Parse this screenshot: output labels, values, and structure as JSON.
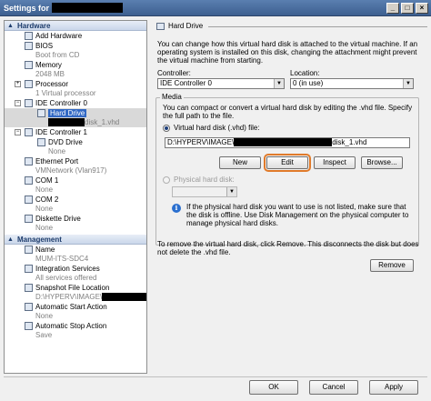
{
  "window": {
    "title": "Settings for"
  },
  "titlebar_buttons": [
    "_",
    "□",
    "×"
  ],
  "tree": {
    "hardware_header": "Hardware",
    "management_header": "Management",
    "hardware_items": [
      {
        "label": "Add Hardware",
        "sub": ""
      },
      {
        "label": "BIOS",
        "sub": "Boot from CD"
      },
      {
        "label": "Memory",
        "sub": "2048 MB"
      },
      {
        "label": "Processor",
        "sub": "1 Virtual processor"
      },
      {
        "label": "IDE Controller 0",
        "sub": ""
      },
      {
        "label": "Hard Drive",
        "sub": "disk_1.vhd"
      },
      {
        "label": "IDE Controller 1",
        "sub": ""
      },
      {
        "label": "DVD Drive",
        "sub": "None"
      },
      {
        "label": "Ethernet Port",
        "sub": "VMNetwork (Vlan917)"
      },
      {
        "label": "COM 1",
        "sub": "None"
      },
      {
        "label": "COM 2",
        "sub": "None"
      },
      {
        "label": "Diskette Drive",
        "sub": "None"
      }
    ],
    "management_items": [
      {
        "label": "Name",
        "sub": "MUM-ITS-SDC4"
      },
      {
        "label": "Integration Services",
        "sub": "All services offered"
      },
      {
        "label": "Snapshot File Location",
        "sub": "D:\\HYPERV\\IMAGE\\"
      },
      {
        "label": "Automatic Start Action",
        "sub": "None"
      },
      {
        "label": "Automatic Stop Action",
        "sub": "Save"
      }
    ]
  },
  "panel": {
    "title": "Hard Drive",
    "intro": "You can change how this virtual hard disk is attached to the virtual machine. If an operating system is installed on this disk, changing the attachment might prevent the virtual machine from starting.",
    "controller_label": "Controller:",
    "controller_value": "IDE Controller 0",
    "location_label": "Location:",
    "location_value": "0 (in use)",
    "media_label": "Media",
    "media_desc": "You can compact or convert a virtual hard disk by editing the .vhd file. Specify the full path to the file.",
    "vhd_radio": "Virtual hard disk (.vhd) file:",
    "vhd_path_prefix": "D:\\HYPERV\\IMAGE\\",
    "vhd_path_suffix": "disk_1.vhd",
    "btn_new": "New",
    "btn_edit": "Edit",
    "btn_inspect": "Inspect",
    "btn_browse": "Browse...",
    "physical_radio": "Physical hard disk:",
    "physical_info": "If the physical hard disk you want to use is not listed, make sure that the disk is offline. Use Disk Management on the physical computer to manage physical hard disks.",
    "remove_desc": "To remove the virtual hard disk, click Remove. This disconnects the disk but does not delete the .vhd file.",
    "btn_remove": "Remove"
  },
  "footer": {
    "ok": "OK",
    "cancel": "Cancel",
    "apply": "Apply"
  },
  "colors": {
    "edit_highlight": "#e07a2a",
    "selection": "#3168c4"
  }
}
